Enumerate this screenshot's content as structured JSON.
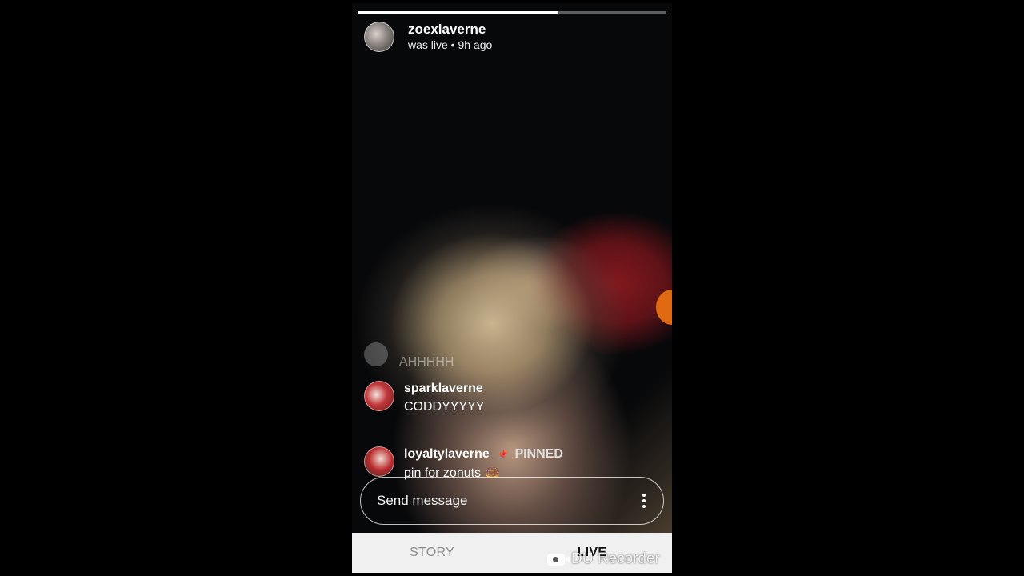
{
  "story": {
    "username": "zoexlaverne",
    "status": "was live • 9h ago",
    "progress_fraction": 0.65
  },
  "comments": [
    {
      "user": "",
      "text": "AHHHHH",
      "faded": true
    },
    {
      "user": "sparklaverne",
      "text": "CODDYYYYY"
    },
    {
      "user": "loyaltylaverne",
      "text": "pin for zonuts 🍩",
      "pinned_label": "PINNED",
      "pin_icon": "pin-icon"
    }
  ],
  "message_bar": {
    "placeholder": "Send message",
    "more_icon": "vertical-dots-icon"
  },
  "tabs": [
    {
      "label": "STORY",
      "active": false
    },
    {
      "label": "LIVE",
      "active": true
    }
  ],
  "watermark": {
    "text": "DU Recorder",
    "icon": "video-camera-icon"
  },
  "colors": {
    "tab_bar_bg": "#f0f0f0",
    "inactive_tab": "#8b8b8b",
    "accent_orange": "#e06a12"
  }
}
